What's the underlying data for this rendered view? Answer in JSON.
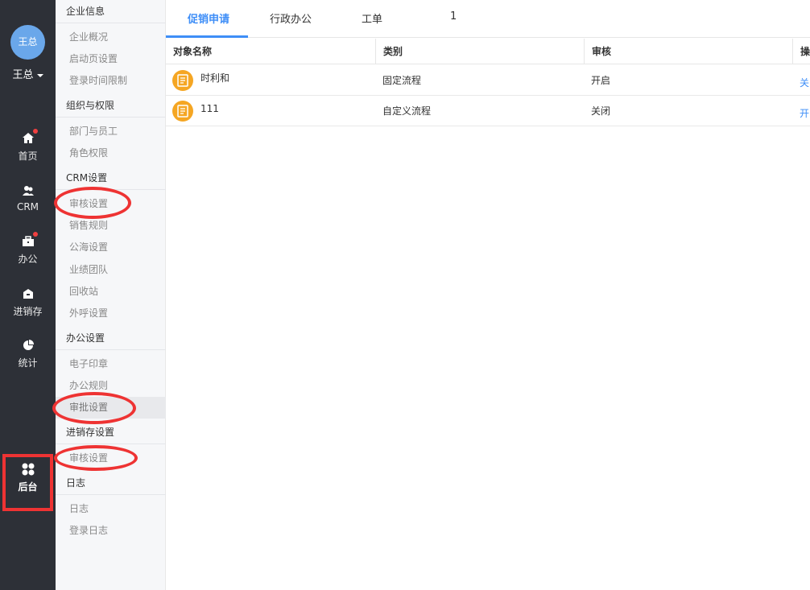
{
  "user": {
    "avatar_text": "王总",
    "name": "王总"
  },
  "nav": [
    {
      "label": "首页",
      "icon": "home-icon"
    },
    {
      "label": "CRM",
      "icon": "users-icon"
    },
    {
      "label": "办公",
      "icon": "briefcase-icon"
    },
    {
      "label": "进销存",
      "icon": "warehouse-icon"
    },
    {
      "label": "统计",
      "icon": "pie-chart-icon"
    },
    {
      "label": "后台",
      "icon": "grid-icon"
    }
  ],
  "menu": {
    "groups": [
      "企业信息",
      "组织与权限",
      "CRM设置",
      "办公设置",
      "进销存设置",
      "日志"
    ],
    "items": {
      "company": [
        "企业概况",
        "启动页设置",
        "登录时间限制"
      ],
      "org": [
        "部门与员工",
        "角色权限"
      ],
      "crm": [
        "审核设置",
        "销售规则",
        "公海设置",
        "业绩团队",
        "回收站",
        "外呼设置"
      ],
      "office": [
        "电子印章",
        "办公规则",
        "审批设置"
      ],
      "inventory": [
        "审核设置"
      ],
      "log": [
        "日志",
        "登录日志"
      ]
    }
  },
  "tabs": [
    {
      "label": "促销申请",
      "active": true
    },
    {
      "label": "行政办公",
      "active": false
    },
    {
      "label": "工单",
      "active": false
    },
    {
      "label": "1",
      "active": false
    }
  ],
  "table": {
    "headers": [
      "对象名称",
      "类别",
      "审核",
      "操"
    ],
    "rows": [
      {
        "name": "时利和",
        "category": "固定流程",
        "status": "开启",
        "action": "关"
      },
      {
        "name": "111",
        "category": "自定义流程",
        "status": "关闭",
        "action": "开"
      }
    ]
  },
  "colors": {
    "accent": "#3e8ef7",
    "sidebar": "#2d3037",
    "highlight": "#ee3333",
    "row_icon": "#f5a623"
  }
}
